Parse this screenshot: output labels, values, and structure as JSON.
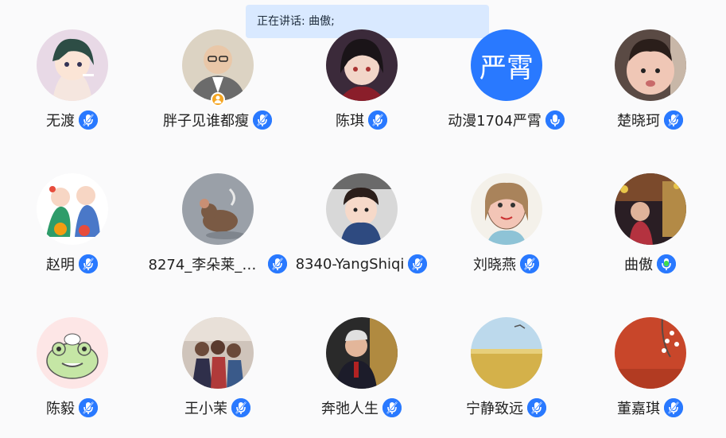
{
  "banner": {
    "speaking_label": "正在讲话: 曲傲;"
  },
  "participants": [
    {
      "name": "无渡",
      "avatar": "anime-girl",
      "mic": "muted"
    },
    {
      "name": "胖子见谁都瘦",
      "avatar": "man-suit",
      "mic": "muted",
      "host": true
    },
    {
      "name": "陈琪",
      "avatar": "anime-girl-dark",
      "mic": "muted"
    },
    {
      "name": "动漫1704严霄",
      "avatar": "initials",
      "initials": "严霄",
      "mic": "on"
    },
    {
      "name": "楚晓珂",
      "avatar": "child-photo",
      "mic": "muted"
    },
    {
      "name": "赵明",
      "avatar": "new-year-kids",
      "mic": "muted"
    },
    {
      "name": "8274_李朵莱_Li...",
      "avatar": "cartoon-mouse",
      "mic": "muted"
    },
    {
      "name": "8340-YangShiqi",
      "avatar": "child-photo-2",
      "mic": "muted"
    },
    {
      "name": "刘晓燕",
      "avatar": "drawing",
      "mic": "muted"
    },
    {
      "name": "曲傲",
      "avatar": "concert",
      "mic": "speaking"
    },
    {
      "name": "陈毅",
      "avatar": "frog",
      "mic": "muted"
    },
    {
      "name": "王小茉",
      "avatar": "group-photo",
      "mic": "muted"
    },
    {
      "name": "奔弛人生",
      "avatar": "man-photo",
      "mic": "muted"
    },
    {
      "name": "宁静致远",
      "avatar": "wheat-field",
      "mic": "muted"
    },
    {
      "name": "董嘉琪",
      "avatar": "red-wall",
      "mic": "muted"
    }
  ],
  "colors": {
    "accent": "#2979ff",
    "banner_bg": "#d9e9ff",
    "speaking_green": "#3ddc4a",
    "host_badge": "#f5a623"
  }
}
